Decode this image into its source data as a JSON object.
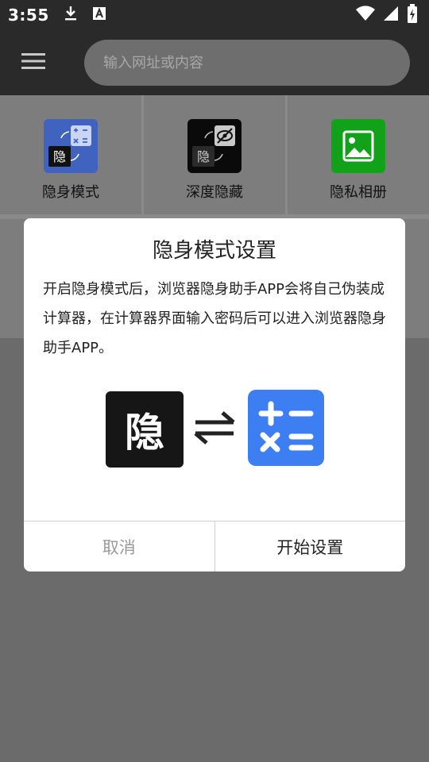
{
  "status_bar": {
    "time": "3:55",
    "icons": [
      "download-icon",
      "a-badge-icon",
      "wifi-icon",
      "signal-icon",
      "battery-charging-icon"
    ]
  },
  "toolbar": {
    "menu_icon": "hamburger-menu-icon",
    "search_placeholder": "输入网址或内容"
  },
  "tools": [
    {
      "label": "隐身模式",
      "icon": "stealth-calculator-icon",
      "color": "#3f63bf"
    },
    {
      "label": "深度隐藏",
      "icon": "deep-hide-icon",
      "color": "#0a0a0a"
    },
    {
      "label": "隐私相册",
      "icon": "private-album-icon",
      "color": "#12a21a"
    }
  ],
  "dialog": {
    "title": "隐身模式设置",
    "body": "开启隐身模式后，浏览器隐身助手APP会将自己伪装成计算器，在计算器界面输入密码后可以进入浏览器隐身助手APP。",
    "left_badge_char": "隐",
    "swap_icon": "swap-arrows-icon",
    "calculator_icon": "calculator-icon",
    "cancel_label": "取消",
    "confirm_label": "开始设置"
  }
}
